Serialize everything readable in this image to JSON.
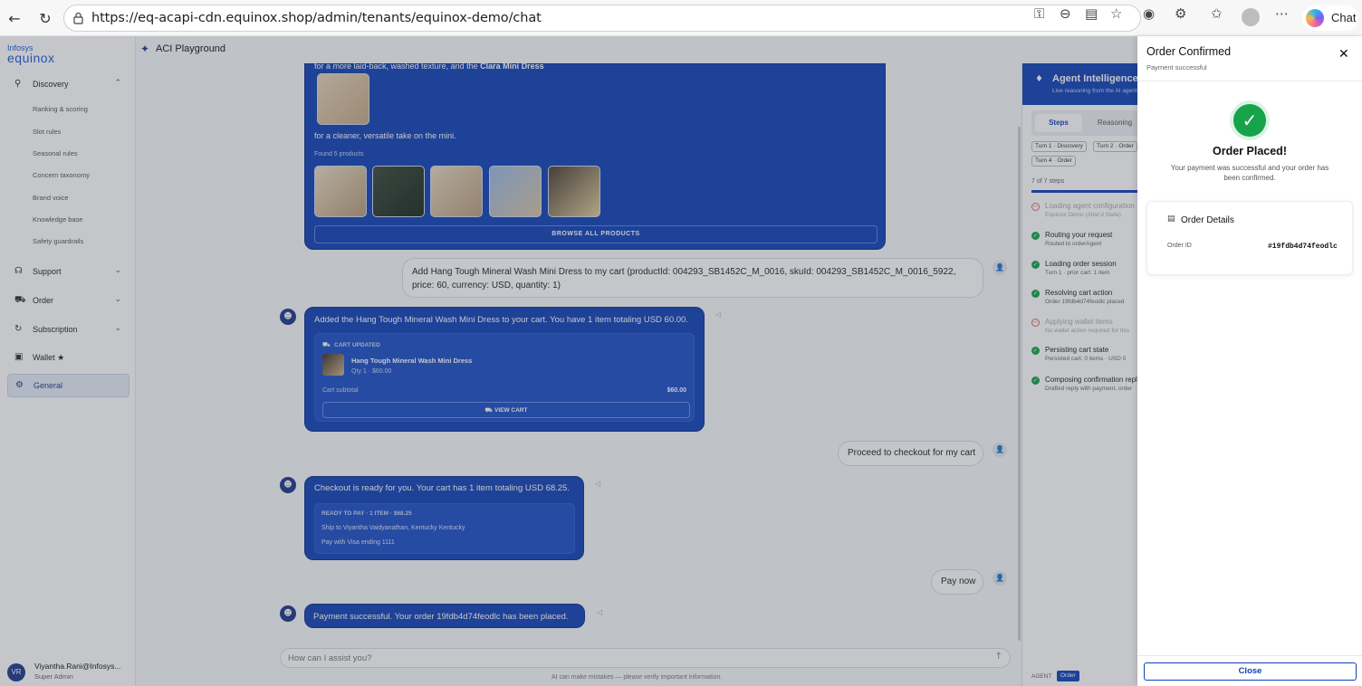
{
  "browser": {
    "url": "https://eq-acapi-cdn.equinox.shop/admin/tenants/equinox-demo/chat",
    "chat_label": "Chat"
  },
  "sidebar": {
    "logo_top": "Infosys",
    "logo_bottom": "equinox",
    "discovery": "Discovery",
    "discovery_items": [
      "Ranking & scoring",
      "Slot rules",
      "Seasonal rules",
      "Concern taxonomy",
      "Brand voice",
      "Knowledge base",
      "Safety guardrails"
    ],
    "support": "Support",
    "order": "Order",
    "subscription": "Subscription",
    "wallet": "Wallet ★",
    "general": "General",
    "user_initials": "VR",
    "user_name": "Viyantha.Rani@Infosys...",
    "user_role": "Super Admin"
  },
  "page": {
    "title": "ACI Playground"
  },
  "chat": {
    "msg1_line1_a": "for a more laid-back, washed texture, and the ",
    "msg1_line1_b": "Clara Mini Dress",
    "msg1_line2": "for a cleaner, versatile take on the mini.",
    "found": "Found 5 products",
    "browse": "BROWSE ALL PRODUCTS",
    "user1": "Add Hang Tough Mineral Wash Mini Dress to my cart (productId: 004293_SB1452C_M_0016, skuId: 004293_SB1452C_M_0016_5922, price: 60, currency: USD, quantity: 1)",
    "bot2": "Added the Hang Tough Mineral Wash Mini Dress to your cart. You have 1 item totaling USD 60.00.",
    "cart_updated": "CART UPDATED",
    "cart_item": "Hang Tough Mineral Wash Mini Dress",
    "cart_qty": "Qty 1 · $60.00",
    "cart_subtotal_label": "Cart subtotal",
    "cart_subtotal": "$60.00",
    "view_cart": "VIEW CART",
    "user2": "Proceed to checkout for my cart",
    "bot3": "Checkout is ready for you. Your cart has 1 item totaling USD 68.25.",
    "ready": "READY TO PAY · 1 ITEM · $68.25",
    "ship": "Ship to Viyantha Vaidyanathan, Kentucky Kentucky",
    "pay": "Pay with Visa ending 1111",
    "user3": "Pay now",
    "bot4": "Payment successful. Your order 19fdb4d74feodlc has been placed.",
    "input_placeholder": "How can I assist you?",
    "disclaimer": "AI can make mistakes — please verify important information."
  },
  "agent": {
    "title": "Agent Intelligence",
    "subtitle": "Live reasoning from the AI agent",
    "tab_steps": "Steps",
    "tab_reasoning": "Reasoning",
    "turns": [
      "Turn 1 · Discovery",
      "Turn 2 · Order",
      "Turn 4 · Order"
    ],
    "step_count": "7 of 7 steps",
    "steps": [
      {
        "title": "Loading agent configuration",
        "desc": "Equinox Demo (Altar'd State)",
        "status": "skipped"
      },
      {
        "title": "Routing your request",
        "desc": "Routed to orderAgent",
        "status": "done"
      },
      {
        "title": "Loading order session",
        "desc": "Turn 1 · prior cart: 1 item",
        "status": "done"
      },
      {
        "title": "Resolving cart action",
        "desc": "Order 19fdb4d74feodlc placed",
        "status": "done"
      },
      {
        "title": "Applying wallet items",
        "desc": "No wallet action required for this",
        "status": "skipped"
      },
      {
        "title": "Persisting cart state",
        "desc": "Persisted cart: 0 items · USD 0",
        "status": "done"
      },
      {
        "title": "Composing confirmation reply",
        "desc": "Drafted reply with payment, order",
        "status": "done"
      }
    ],
    "footer_label": "AGENT",
    "footer_tag": "Order"
  },
  "drawer": {
    "title": "Order Confirmed",
    "subtitle": "Payment successful",
    "headline": "Order Placed!",
    "message": "Your payment was successful and your order has been confirmed.",
    "details_title": "Order Details",
    "order_id_label": "Order ID",
    "order_id": "#19fdb4d74feodlc",
    "close": "Close"
  },
  "colors": {
    "brand": "#1242b8",
    "success": "#16a34a"
  }
}
